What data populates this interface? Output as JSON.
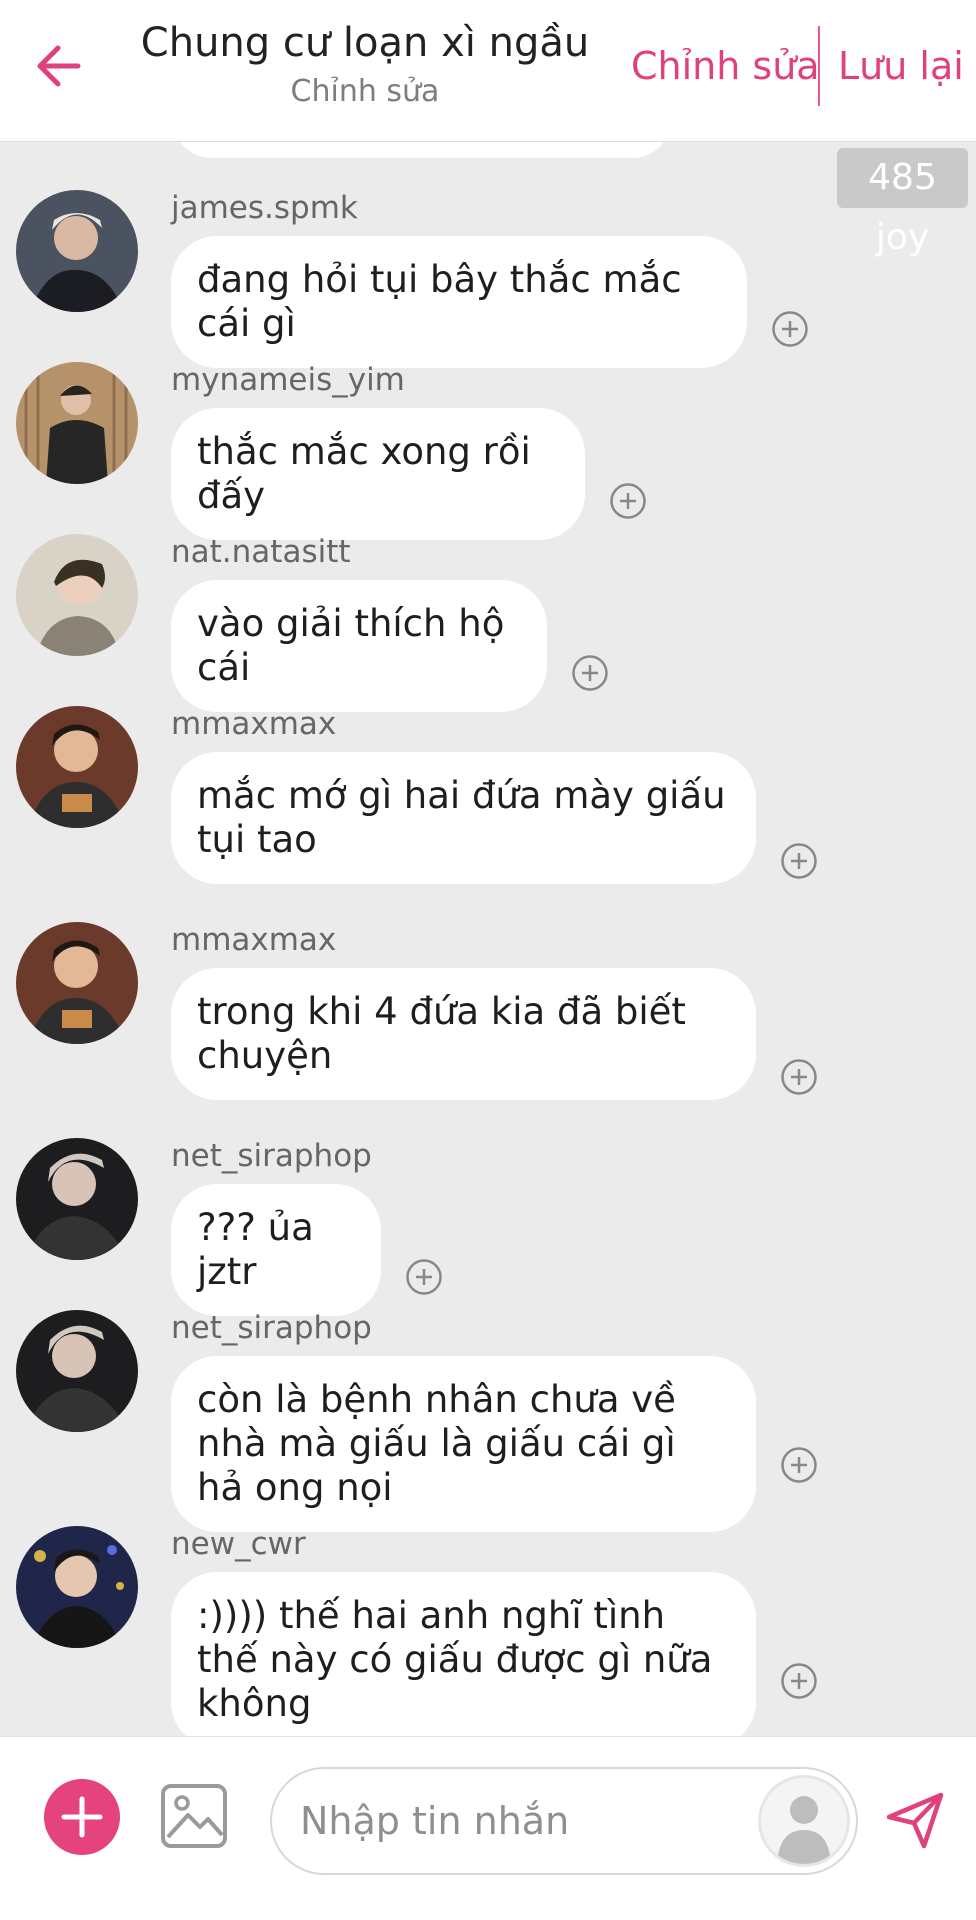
{
  "header": {
    "title": "Chung cư loạn xì ngầu",
    "subtitle": "Chỉnh sửa",
    "edit_label": "Chỉnh sửa",
    "save_label": "Lưu lại"
  },
  "joy_badge": "485 joy",
  "messages": [
    {
      "username": "james.spmk",
      "text": "đang hỏi tụi bây thắc mắc cái gì"
    },
    {
      "username": "mynameis_yim",
      "text": "thắc mắc xong rồi đấy"
    },
    {
      "username": "nat.natasitt",
      "text": "vào giải thích hộ cái"
    },
    {
      "username": "mmaxmax",
      "text": "mắc mớ gì hai đứa mày giấu tụi tao"
    },
    {
      "username": "mmaxmax",
      "text": "trong khi 4 đứa kia đã biết chuyện"
    },
    {
      "username": "net_siraphop",
      "text": "??? ủa jztr"
    },
    {
      "username": "net_siraphop",
      "text": "còn là bệnh nhân chưa về nhà mà giấu là giấu cái gì hả ong nọi"
    },
    {
      "username": "new_cwr",
      "text": ":)))) thế hai anh nghĩ tình thế này có giấu được gì nữa không"
    }
  ],
  "composer": {
    "placeholder": "Nhập tin nhắn"
  },
  "colors": {
    "accent": "#e0407d",
    "background": "#ebebeb",
    "bubble": "#ffffff"
  }
}
